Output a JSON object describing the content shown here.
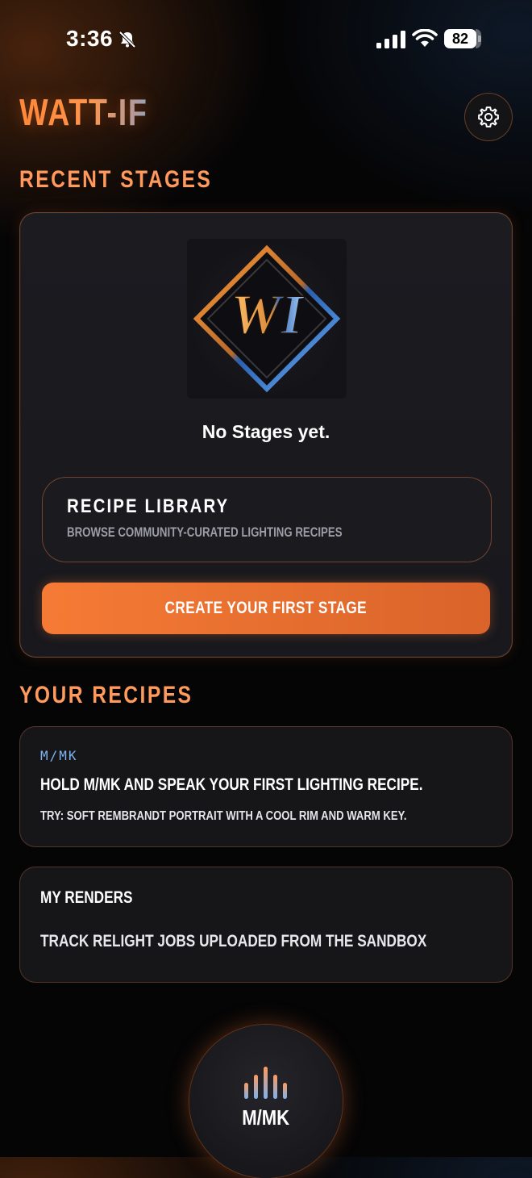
{
  "status_bar": {
    "time": "3:36",
    "battery": "82",
    "battery_level": 0.82
  },
  "header": {
    "logo": "WATT-IF",
    "settings_icon": "gear-icon"
  },
  "recent_stages": {
    "title": "RECENT STAGES",
    "empty_text": "No Stages yet.",
    "library": {
      "title": "RECIPE LIBRARY",
      "subtitle": "BROWSE COMMUNITY-CURATED LIGHTING RECIPES"
    },
    "create_button": "CREATE YOUR FIRST STAGE",
    "logo_letters": "WI"
  },
  "your_recipes": {
    "title": "YOUR RECIPES",
    "card": {
      "tag": "M/MK",
      "title": "HOLD M/MK AND SPEAK YOUR FIRST LIGHTING RECIPE.",
      "hint": "TRY: SOFT REMBRANDT PORTRAIT WITH A COOL RIM AND WARM KEY."
    },
    "renders": {
      "title": "MY RENDERS",
      "description": "TRACK RELIGHT JOBS UPLOADED FROM THE SANDBOX"
    }
  },
  "mic": {
    "label": "M/MK",
    "icon": "audio-bars-icon"
  },
  "colors": {
    "accent": "#f57b35",
    "accent_text": "#ff9a5c",
    "tag_blue": "#7fb2ee",
    "background": "#050506"
  }
}
